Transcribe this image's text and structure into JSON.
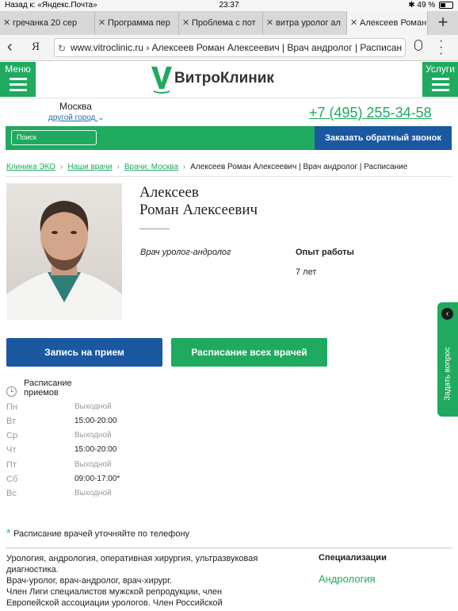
{
  "status": {
    "back_app": "Назад к: «Яндекс.Почта»",
    "time": "23:37",
    "battery": "49 %"
  },
  "tabs": [
    {
      "label": "гречанка 20 сер"
    },
    {
      "label": "Программа пер"
    },
    {
      "label": "Проблема с пот"
    },
    {
      "label": "витра уролог ал"
    },
    {
      "label": "Алексеев Роман"
    }
  ],
  "addressbar": {
    "ya": "Я",
    "url": "www.vitroclinic.ru › Алексеев Роман Алексеевич | Врач андролог | Расписан"
  },
  "header": {
    "menu_label": "Меню",
    "services_label": "Услуги",
    "logo_text": "ВитроКлиник",
    "city": "Москва",
    "other_city": "другой город",
    "phone": "+7 (495) 255-34-58",
    "search_placeholder": "Поиск",
    "callback_label": "Заказать обратный звонок"
  },
  "breadcrumbs": {
    "items": [
      "Клиника ЭКО",
      "Наши врачи",
      "Врачи. Москва"
    ],
    "current": "Алексеев Роман Алексеевич | Врач андролог | Расписание"
  },
  "doctor": {
    "last_name": "Алексеев",
    "first_names": "Роман Алексеевич",
    "specialty": "Врач уролог-андролог",
    "experience_label": "Опыт работы",
    "experience_value": "7 лет",
    "book_label": "Запись на прием",
    "all_schedule_label": "Расписание всех врачей"
  },
  "feedback_label": "Задать вопрос",
  "schedule": {
    "title": "Расписание приемов",
    "days": [
      {
        "day": "Пн",
        "time": "Выходной",
        "work": false
      },
      {
        "day": "Вт",
        "time": "15:00-20:00",
        "work": true
      },
      {
        "day": "Ср",
        "time": "Выходной",
        "work": false
      },
      {
        "day": "Чт",
        "time": "15:00-20:00",
        "work": true
      },
      {
        "day": "Пт",
        "time": "Выходной",
        "work": false
      },
      {
        "day": "Сб",
        "time": "09:00-17:00*",
        "work": true
      },
      {
        "day": "Вс",
        "time": "Выходной",
        "work": false
      }
    ],
    "note_star": "*",
    "note": "Расписание врачей уточняйте по телефону"
  },
  "about": {
    "line1": "Урология, андрология, оперативная хирургия, ультразвуковая",
    "line2": "диагностика.",
    "line3": "Врач-уролог, врач-андролог, врач-хирург.",
    "line4": "Член Лиги специалистов мужской репродукции, член",
    "line5": "Европейской ассоциации урологов. Член Российской"
  },
  "specializations": {
    "title": "Специализации",
    "item": "Андрология"
  },
  "colors": {
    "brand_green": "#1faa5f",
    "brand_blue": "#1a58a2"
  }
}
